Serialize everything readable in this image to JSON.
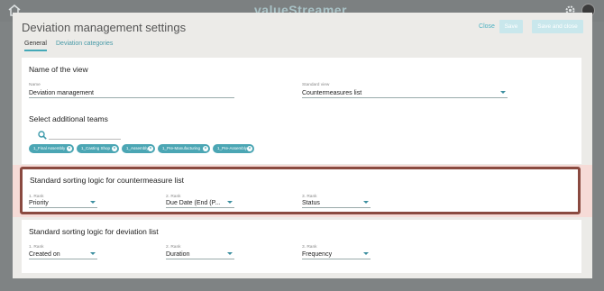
{
  "brand": {
    "name": "valueStreamer"
  },
  "icons": {
    "home": "home-icon",
    "settings": "gear-icon",
    "search": "search-icon",
    "remove": "close-icon",
    "dropdown": "chevron-down-icon"
  },
  "colors": {
    "accent": "#45a9b8",
    "highlight_border": "#8a4a40"
  },
  "modal": {
    "title": "Deviation management settings",
    "close_label": "Close",
    "save_label": "Save",
    "save_close_label": "Save and close"
  },
  "tabs": [
    {
      "label": "General",
      "active": true
    },
    {
      "label": "Deviation categories",
      "active": false
    }
  ],
  "view_section": {
    "title": "Name of the view",
    "name_label": "Name",
    "name_value": "Deviation management",
    "standard_view_label": "Standard view",
    "standard_view_value": "Countermeasures list"
  },
  "teams_section": {
    "title": "Select additional teams",
    "chips": [
      "1_Final Assembly",
      "1_Casting Shop",
      "1_Assembly",
      "1_Pre-Manufacturing",
      "1_Pre-Assembly"
    ]
  },
  "countermeasure_sort": {
    "title": "Standard sorting logic for countermeasure list",
    "ranks": [
      {
        "label": "1. Rank",
        "value": "Priority"
      },
      {
        "label": "2. Rank",
        "value": "Due Date (End (P..."
      },
      {
        "label": "3. Rank",
        "value": "Status"
      }
    ]
  },
  "deviation_sort": {
    "title": "Standard sorting logic for deviation list",
    "ranks": [
      {
        "label": "1. Rank",
        "value": "Created on"
      },
      {
        "label": "2. Rank",
        "value": "Duration"
      },
      {
        "label": "3. Rank",
        "value": "Frequency"
      }
    ]
  }
}
